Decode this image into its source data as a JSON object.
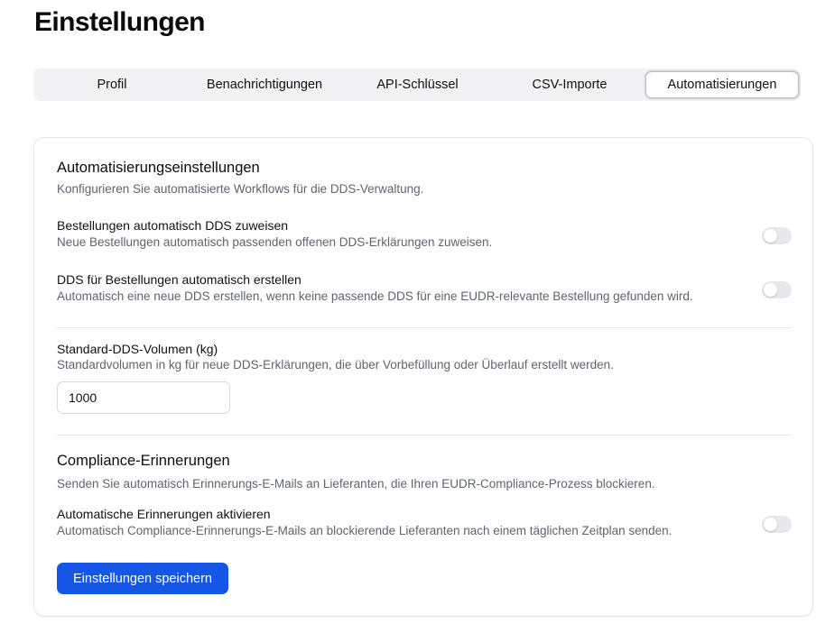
{
  "page": {
    "title": "Einstellungen"
  },
  "tabs": [
    {
      "label": "Profil"
    },
    {
      "label": "Benachrichtigungen"
    },
    {
      "label": "API-Schlüssel"
    },
    {
      "label": "CSV-Importe"
    },
    {
      "label": "Automatisierungen",
      "active": true
    }
  ],
  "automation": {
    "title": "Automatisierungseinstellungen",
    "description": "Konfigurieren Sie automatisierte Workflows für die DDS-Verwaltung.",
    "assign": {
      "title": "Bestellungen automatisch DDS zuweisen",
      "description": "Neue Bestellungen automatisch passenden offenen DDS-Erklärungen zuweisen.",
      "enabled": false
    },
    "create": {
      "title": "DDS für Bestellungen automatisch erstellen",
      "description": "Automatisch eine neue DDS erstellen, wenn keine passende DDS für eine EUDR-relevante Bestellung gefunden wird.",
      "enabled": false
    }
  },
  "volume": {
    "title": "Standard-DDS-Volumen (kg)",
    "description": "Standardvolumen in kg für neue DDS-Erklärungen, die über Vorbefüllung oder Überlauf erstellt werden.",
    "value": "1000"
  },
  "compliance": {
    "title": "Compliance-Erinnerungen",
    "description": "Senden Sie automatisch Erinnerungs-E-Mails an Lieferanten, die Ihren EUDR-Compliance-Prozess blockieren.",
    "reminders": {
      "title": "Automatische Erinnerungen aktivieren",
      "description": "Automatisch Compliance-Erinnerungs-E-Mails an blockierende Lieferanten nach einem täglichen Zeitplan senden.",
      "enabled": false
    }
  },
  "actions": {
    "save_label": "Einstellungen speichern"
  },
  "colors": {
    "primary": "#1556e6",
    "toggle_off": "#e7e8eb",
    "muted_text": "#5f6470",
    "tabs_bg": "#f2f2f4"
  }
}
